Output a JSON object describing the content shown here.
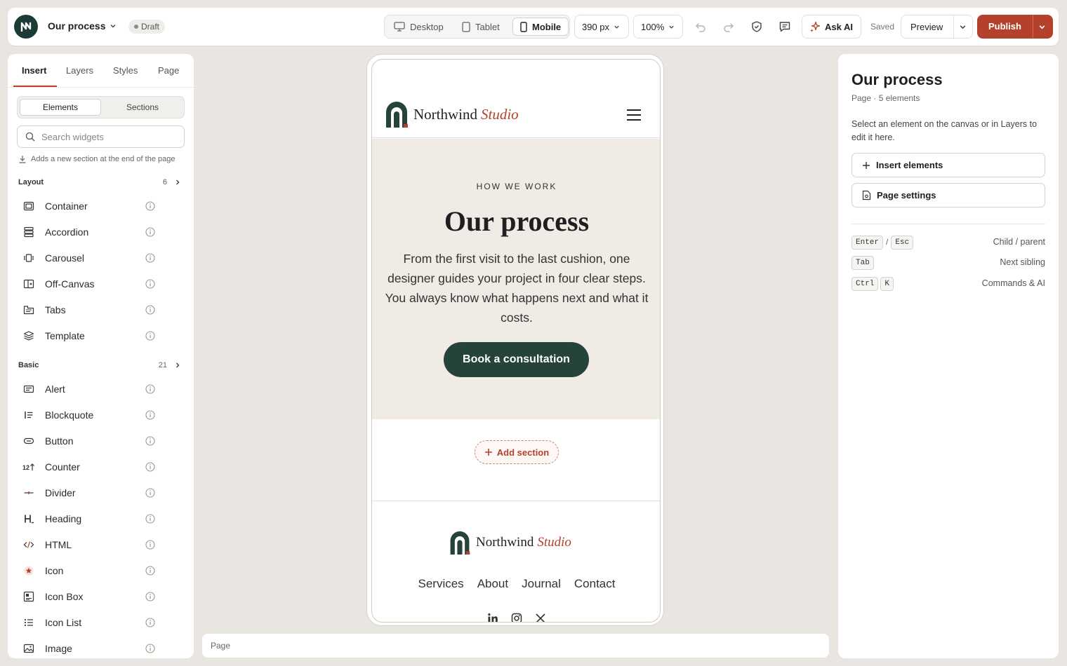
{
  "topbar": {
    "doc_title": "Our process",
    "status_badge": "Draft",
    "devices": [
      {
        "label": "Desktop",
        "icon": "monitor-icon",
        "active": false
      },
      {
        "label": "Tablet",
        "icon": "tablet-icon",
        "active": false
      },
      {
        "label": "Mobile",
        "icon": "mobile-icon",
        "active": true
      }
    ],
    "width_value": "390 px",
    "zoom_value": "100%",
    "ask_ai_label": "Ask AI",
    "saved_label": "Saved",
    "preview_label": "Preview",
    "publish_label": "Publish",
    "accent_color": "#b3412b"
  },
  "left_panel": {
    "tabs": [
      {
        "label": "Insert",
        "active": true
      },
      {
        "label": "Layers",
        "active": false
      },
      {
        "label": "Styles",
        "active": false
      },
      {
        "label": "Page",
        "active": false
      }
    ],
    "segments": [
      {
        "label": "Elements",
        "active": true
      },
      {
        "label": "Sections",
        "active": false
      }
    ],
    "search_placeholder": "Search widgets",
    "hint": "Adds a new section at the end of the page",
    "categories": [
      {
        "name": "Layout",
        "count": "6",
        "items": [
          {
            "label": "Container",
            "icon": "container-icon"
          },
          {
            "label": "Accordion",
            "icon": "accordion-icon"
          },
          {
            "label": "Carousel",
            "icon": "carousel-icon"
          },
          {
            "label": "Off-Canvas",
            "icon": "off-canvas-icon"
          },
          {
            "label": "Tabs",
            "icon": "tabs-icon"
          },
          {
            "label": "Template",
            "icon": "template-icon"
          }
        ]
      },
      {
        "name": "Basic",
        "count": "21",
        "items": [
          {
            "label": "Alert",
            "icon": "alert-icon"
          },
          {
            "label": "Blockquote",
            "icon": "blockquote-icon"
          },
          {
            "label": "Button",
            "icon": "button-icon"
          },
          {
            "label": "Counter",
            "icon": "counter-icon"
          },
          {
            "label": "Divider",
            "icon": "divider-icon"
          },
          {
            "label": "Heading",
            "icon": "heading-icon"
          },
          {
            "label": "HTML",
            "icon": "html-icon"
          },
          {
            "label": "Icon",
            "icon": "star-icon"
          },
          {
            "label": "Icon Box",
            "icon": "icon-box-icon"
          },
          {
            "label": "Icon List",
            "icon": "icon-list-icon"
          },
          {
            "label": "Image",
            "icon": "image-icon"
          }
        ]
      }
    ]
  },
  "canvas": {
    "site": {
      "brand_main": "Northwind",
      "brand_accent": "Studio",
      "eyebrow": "HOW WE WORK",
      "hero_title": "Our process",
      "hero_text": "From the first visit to the last cushion, one designer guides your project in four clear steps. You always know what happens next and what it costs.",
      "cta_label": "Book a consultation",
      "footer_nav": [
        "Services",
        "About",
        "Journal",
        "Contact"
      ],
      "brand_color": "#264339",
      "hero_bg": "#f0ebe4"
    },
    "add_section_label": "Add section"
  },
  "status_bar": {
    "label": "Page"
  },
  "right_panel": {
    "title": "Our process",
    "meta": "Page · 5 elements",
    "description": "Select an element on the canvas or in Layers to edit it here.",
    "insert_label": "Insert elements",
    "page_settings_label": "Page settings",
    "shortcuts": [
      {
        "keys": [
          "Enter",
          "Esc"
        ],
        "sep": "/",
        "desc": "Child / parent"
      },
      {
        "keys": [
          "Tab"
        ],
        "sep": "",
        "desc": "Next sibling"
      },
      {
        "keys": [
          "Ctrl",
          "K"
        ],
        "sep": "",
        "desc": "Commands & AI"
      }
    ]
  }
}
